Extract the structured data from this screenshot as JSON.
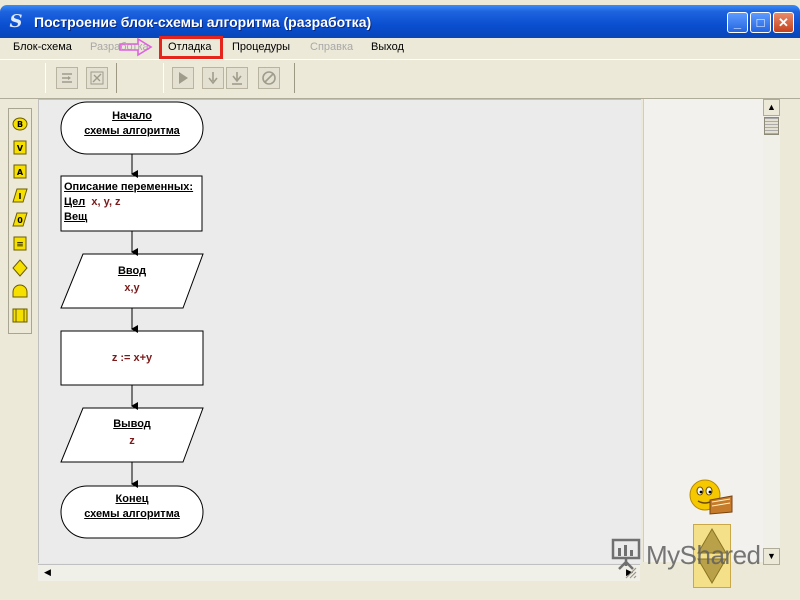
{
  "window": {
    "title": "Построение блок-схемы алгоритма (разработка)",
    "app_icon": "S",
    "controls": {
      "minimize": "_",
      "maximize": "□",
      "close": "✕"
    }
  },
  "menu": {
    "items": [
      {
        "label": "Блок-схема",
        "disabled": false
      },
      {
        "label": "Разработка",
        "disabled": true
      },
      {
        "label": "Отладка",
        "disabled": false,
        "highlighted": true
      },
      {
        "label": "Процедуры",
        "disabled": false
      },
      {
        "label": "Справка",
        "disabled": true
      },
      {
        "label": "Выход",
        "disabled": false
      }
    ]
  },
  "toolbar": {
    "icons": [
      "step-over-icon",
      "watch-icon",
      "run-icon",
      "step-into-icon",
      "step-out-icon",
      "stop-icon"
    ]
  },
  "left_toolbar": {
    "tools": [
      {
        "icon": "begin-block-icon",
        "glyph": "B"
      },
      {
        "icon": "input-block-icon",
        "glyph": "V"
      },
      {
        "icon": "assign-block-icon",
        "glyph": "A"
      },
      {
        "icon": "output-block-icon",
        "glyph": "I"
      },
      {
        "icon": "loop-block-icon",
        "glyph": "0"
      },
      {
        "icon": "list-block-icon",
        "glyph": "≡"
      },
      {
        "icon": "decision-block-icon",
        "glyph": "◇"
      },
      {
        "icon": "end-block-icon",
        "glyph": "⌓"
      },
      {
        "icon": "procedure-block-icon",
        "glyph": "▯"
      }
    ]
  },
  "flowchart": {
    "start": {
      "line1": "Начало",
      "line2": "схемы алгоритма"
    },
    "vars": {
      "title": "Описание переменных:",
      "int_label": "Цел",
      "int_vars": "x, y, z",
      "real_label": "Вещ"
    },
    "input": {
      "title": "Ввод",
      "vars": "x,y"
    },
    "assign": {
      "expr": "z := x+y"
    },
    "output": {
      "title": "Вывод",
      "vars": "z"
    },
    "end": {
      "line1": "Конец",
      "line2": "схемы алгоритма"
    }
  },
  "watermark": {
    "text": "MyShared"
  },
  "colors": {
    "title_bar": "#0a4fd0",
    "highlight": "#e5251b",
    "nav_box": "#f5e08a",
    "pink_arrow": "#e060e0"
  }
}
